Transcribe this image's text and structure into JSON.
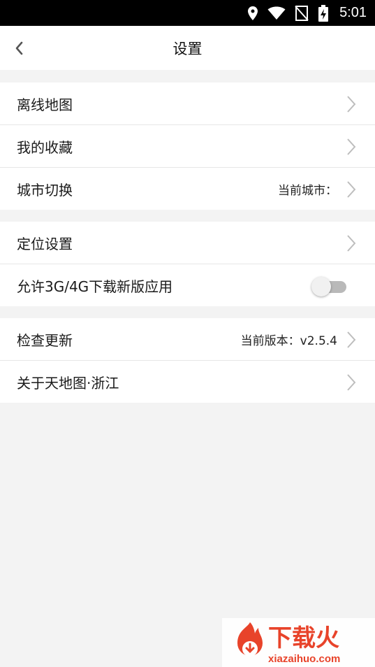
{
  "status_bar": {
    "time": "5:01",
    "icons": [
      "location-icon",
      "wifi-icon",
      "no-sim-icon",
      "battery-charging-icon"
    ]
  },
  "header": {
    "back_icon": "chevron-left-icon",
    "title": "设置"
  },
  "groups": [
    {
      "items": [
        {
          "label": "离线地图",
          "value": "",
          "control": "chevron"
        },
        {
          "label": "我的收藏",
          "value": "",
          "control": "chevron"
        },
        {
          "label": "城市切换",
          "value": "当前城市：",
          "control": "chevron"
        }
      ]
    },
    {
      "items": [
        {
          "label": "定位设置",
          "value": "",
          "control": "chevron"
        },
        {
          "label": "允许3G/4G下载新版应用",
          "value": "",
          "control": "toggle",
          "toggle_on": false
        }
      ]
    },
    {
      "items": [
        {
          "label": "检查更新",
          "value": "当前版本：v2.5.4",
          "control": "chevron"
        },
        {
          "label": "关于天地图·浙江",
          "value": "",
          "control": "chevron"
        }
      ]
    }
  ],
  "watermark": {
    "brand": "下载火",
    "url": "xiazaihuo.com",
    "color": "#e8432a"
  }
}
